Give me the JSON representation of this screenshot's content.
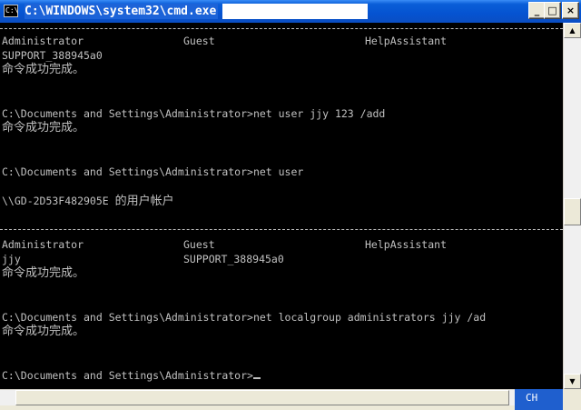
{
  "window": {
    "title": "C:\\WINDOWS\\system32\\cmd.exe",
    "icon_text": "C:\\",
    "minimize_label": "_",
    "maximize_label": "□",
    "close_label": "×"
  },
  "console": {
    "lines": [
      {
        "type": "cols",
        "cols": [
          "Administrator",
          "Guest",
          "HelpAssistant"
        ]
      },
      {
        "type": "text",
        "text": "SUPPORT_388945a0"
      },
      {
        "type": "cjk",
        "text": "命令成功完成。"
      },
      {
        "type": "text",
        "text": ""
      },
      {
        "type": "text",
        "text": ""
      },
      {
        "type": "text",
        "text": "C:\\Documents and Settings\\Administrator>net user jjy 123 /add"
      },
      {
        "type": "cjk",
        "text": "命令成功完成。"
      },
      {
        "type": "text",
        "text": ""
      },
      {
        "type": "text",
        "text": ""
      },
      {
        "type": "text",
        "text": "C:\\Documents and Settings\\Administrator>net user"
      },
      {
        "type": "text",
        "text": ""
      },
      {
        "type": "mixed",
        "text": "\\\\GD-2D53F482905E ",
        "cjk": "的用户帐户"
      },
      {
        "type": "text",
        "text": ""
      },
      {
        "type": "rule"
      },
      {
        "type": "cols",
        "cols": [
          "Administrator",
          "Guest",
          "HelpAssistant"
        ]
      },
      {
        "type": "cols",
        "cols": [
          "jjy",
          "SUPPORT_388945a0",
          ""
        ]
      },
      {
        "type": "cjk",
        "text": "命令成功完成。"
      },
      {
        "type": "text",
        "text": ""
      },
      {
        "type": "text",
        "text": ""
      },
      {
        "type": "text",
        "text": "C:\\Documents and Settings\\Administrator>net localgroup administrators jjy /ad"
      },
      {
        "type": "cjk",
        "text": "命令成功完成。"
      },
      {
        "type": "text",
        "text": ""
      },
      {
        "type": "text",
        "text": ""
      },
      {
        "type": "prompt",
        "text": "C:\\Documents and Settings\\Administrator>"
      }
    ]
  },
  "ime": {
    "label": "CH"
  },
  "scrollbar": {
    "up_arrow": "▲",
    "down_arrow": "▼"
  }
}
